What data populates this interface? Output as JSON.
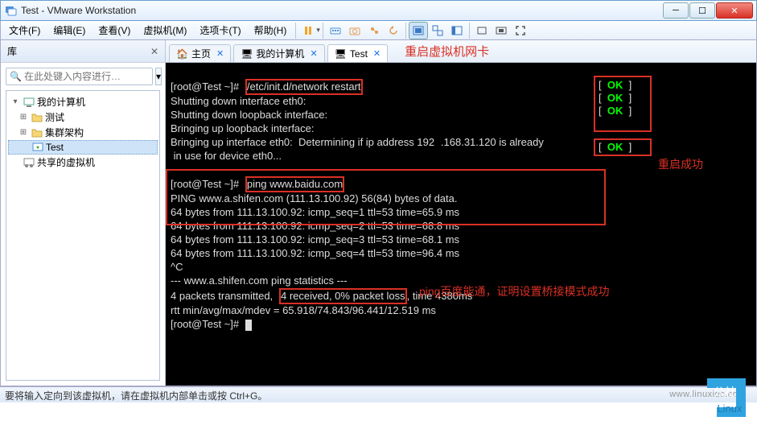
{
  "window": {
    "title": "Test - VMware Workstation"
  },
  "menu": {
    "file": "文件(F)",
    "edit": "编辑(E)",
    "view": "查看(V)",
    "vm": "虚拟机(M)",
    "tabs": "选项卡(T)",
    "help": "帮助(H)"
  },
  "sidebar": {
    "title": "库",
    "search_placeholder": "在此处键入内容进行…",
    "nodes": {
      "root": "我的计算机",
      "n1": "测试",
      "n2": "集群架构",
      "n3": "Test",
      "shared": "共享的虚拟机"
    }
  },
  "tabs": {
    "home": "主页",
    "mypc": "我的计算机",
    "test": "Test"
  },
  "annotations": {
    "restart_nic": "重启虚拟机网卡",
    "restart_ok": "重启成功",
    "ping_ok": "ping百度能通，证明设置桥接模式成功"
  },
  "terminal": {
    "prompt": "[root@Test ~]#",
    "cmd1": "/etc/init.d/network restart",
    "l2": "Shutting down interface eth0:",
    "l3": "Shutting down loopback interface:",
    "l4": "Bringing up loopback interface:",
    "l5a": "Bringing up interface eth0:  Determining if ip address 192",
    "l5b": ".168.31.120 is already",
    "l6": " in use for device eth0...",
    "ok": "OK",
    "cmd2": "ping www.baidu.com",
    "ping_head": "PING www.a.shifen.com (111.13.100.92) 56(84) bytes of data.",
    "r1": "64 bytes from 111.13.100.92: icmp_seq=1 ttl=53 time=65.9 ms",
    "r2": "64 bytes from 111.13.100.92: icmp_seq=2 ttl=53 time=68.8 ms",
    "r3": "64 bytes from 111.13.100.92: icmp_seq=3 ttl=53 time=68.1 ms",
    "r4": "64 bytes from 111.13.100.92: icmp_seq=4 ttl=53 time=96.4 ms",
    "ctrlc": "^C",
    "stats1": "--- www.a.shifen.com ping statistics ---",
    "stats2a": "4 packets transmitted,",
    "stats2b": "4 received, 0% packet loss",
    "stats2c": ", time 4380ms",
    "stats3": "rtt min/avg/max/mdev = 65.918/74.843/96.441/12.519 ms"
  },
  "status": {
    "text": "要将输入定向到该虚拟机，请在虚拟机内部单击或按 Ctrl+G。"
  },
  "watermark": "www.linuxidc.com",
  "logo": {
    "top": "公社",
    "bottom": "Linux"
  }
}
